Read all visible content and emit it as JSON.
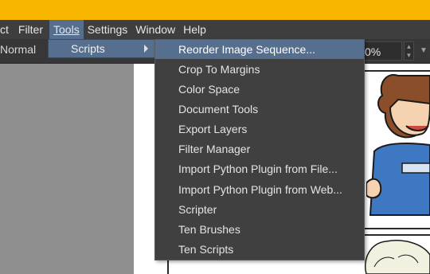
{
  "menubar": {
    "items": [
      {
        "label": "ct"
      },
      {
        "label": "Filter"
      },
      {
        "label": "Tools"
      },
      {
        "label": "Settings"
      },
      {
        "label": "Window"
      },
      {
        "label": "Help"
      }
    ]
  },
  "toolbar": {
    "blend_mode": "Normal",
    "opacity": "0%"
  },
  "scripts_menu": {
    "label": "Scripts"
  },
  "scripts_submenu": {
    "items": [
      "Reorder Image Sequence...",
      "Crop To Margins",
      "Color Space",
      "Document Tools",
      "Export Layers",
      "Filter Manager",
      "Import Python Plugin from File...",
      "Import Python Plugin from Web...",
      "Scripter",
      "Ten Brushes",
      "Ten Scripts"
    ]
  },
  "colors": {
    "title_strip": "#f7b500",
    "highlight": "#566f8e",
    "menu_bg": "#404040"
  }
}
